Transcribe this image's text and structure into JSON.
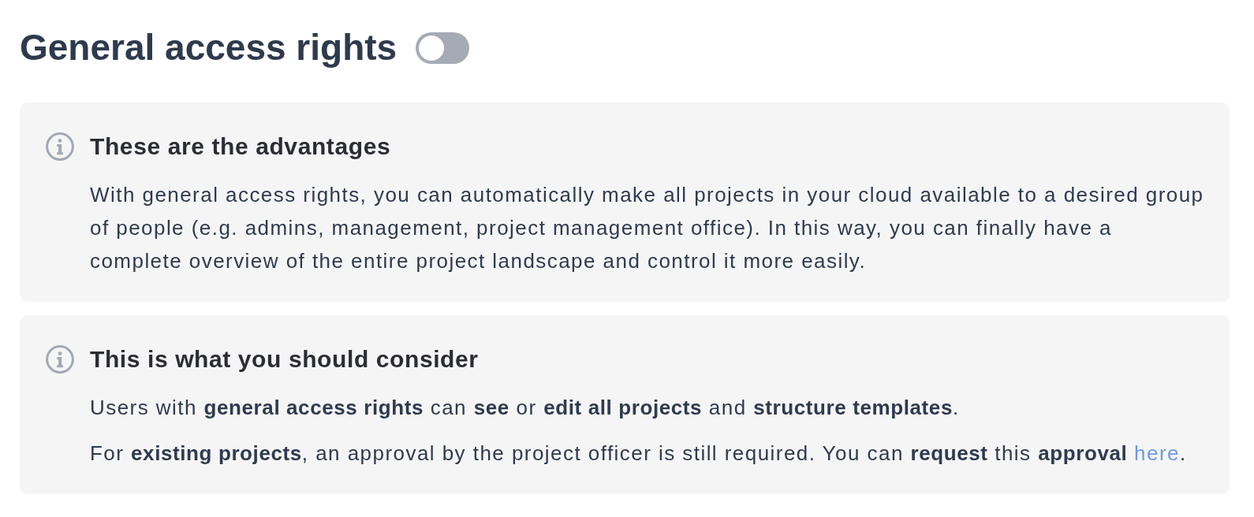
{
  "title": "General access rights",
  "toggle": {
    "on": false
  },
  "notices": [
    {
      "heading": "These are the advantages",
      "paragraphs": [
        {
          "parts": [
            {
              "kind": "text",
              "text": "With general access rights, you can automatically make all projects in your cloud available to a desired group of people (e.g. admins, management, project management office). In this way, you can finally have a complete overview of the entire project landscape and control it more easily."
            }
          ]
        }
      ]
    },
    {
      "heading": "This is what you should consider",
      "paragraphs": [
        {
          "parts": [
            {
              "kind": "text",
              "text": "Users with **general access rights** can **see** or **edit all projects** and **structure templates**."
            }
          ]
        },
        {
          "parts": [
            {
              "kind": "text",
              "text": "For **existing projects**, an approval by the project officer is still required. You can **request** this **approval** "
            },
            {
              "kind": "link",
              "text": "here"
            },
            {
              "kind": "text",
              "text": "."
            }
          ]
        }
      ]
    }
  ]
}
